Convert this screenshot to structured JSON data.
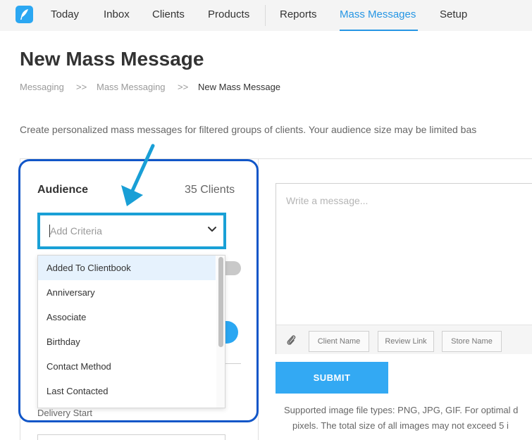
{
  "nav": {
    "items": [
      {
        "label": "Today"
      },
      {
        "label": "Inbox"
      },
      {
        "label": "Clients"
      },
      {
        "label": "Products"
      },
      {
        "label": "Reports"
      },
      {
        "label": "Mass Messages",
        "active": true
      },
      {
        "label": "Setup"
      }
    ],
    "logo_icon": "feather-pen-icon",
    "accent_color": "#2696e4"
  },
  "page": {
    "title": "New Mass Message",
    "breadcrumb": {
      "items": [
        "Messaging",
        "Mass Messaging",
        "New Mass Message"
      ],
      "separator": ">>"
    },
    "description": "Create personalized mass messages for filtered groups of clients. Your audience size may be limited bas"
  },
  "audience": {
    "label": "Audience",
    "count": "35 Clients",
    "criteria_placeholder": "Add Criteria",
    "options": [
      "Added To Clientbook",
      "Anniversary",
      "Associate",
      "Birthday",
      "Contact Method",
      "Last Contacted"
    ],
    "highlighted_option": "Added To Clientbook",
    "delivery_label": "Delivery Start"
  },
  "message": {
    "placeholder": "Write a message...",
    "attach_icon": "paperclip-icon",
    "tags": [
      "Client Name",
      "Review Link",
      "Store Name"
    ],
    "submit_label": "SUBMIT",
    "support_line1": "Supported image file types: PNG, JPG, GIF. For optimal d",
    "support_line2": "pixels. The total size of all images may not exceed 5 i"
  },
  "annotation": {
    "highlight_color": "#1156c8",
    "arrow_color": "#199fd6"
  }
}
